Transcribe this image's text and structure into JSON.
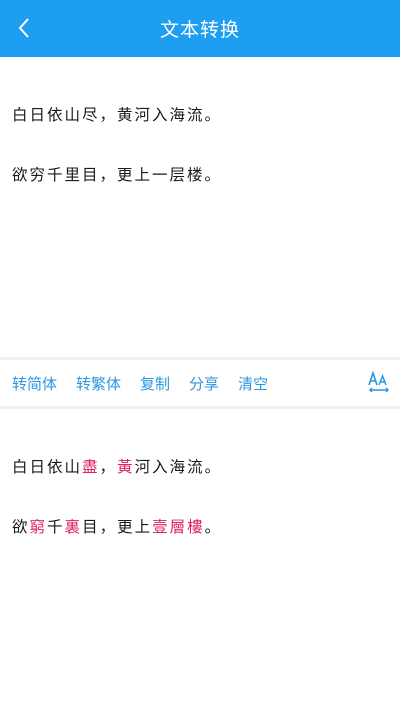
{
  "header": {
    "title": "文本转换",
    "back_icon": "chevron-left-icon",
    "background": "#1e9ef0"
  },
  "input": {
    "lines": [
      "白日依山尽，黄河入海流。",
      "欲穷千里目，更上一层楼。"
    ]
  },
  "toolbar": {
    "simplified_label": "转简体",
    "traditional_label": "转繁体",
    "copy_label": "复制",
    "share_label": "分享",
    "clear_label": "清空",
    "font_size_icon": "font-size-icon",
    "accent": "#2b96e2"
  },
  "output": {
    "highlight_color": "#e0245e",
    "line1": {
      "a": "白日依山",
      "b": "盡",
      "c": "，",
      "d": "黃",
      "e": "河入海流。"
    },
    "line2": {
      "a": "欲",
      "b": "窮",
      "c": "千",
      "d": "裏",
      "e": "目，更上",
      "f": "壹層樓",
      "g": "。"
    }
  }
}
